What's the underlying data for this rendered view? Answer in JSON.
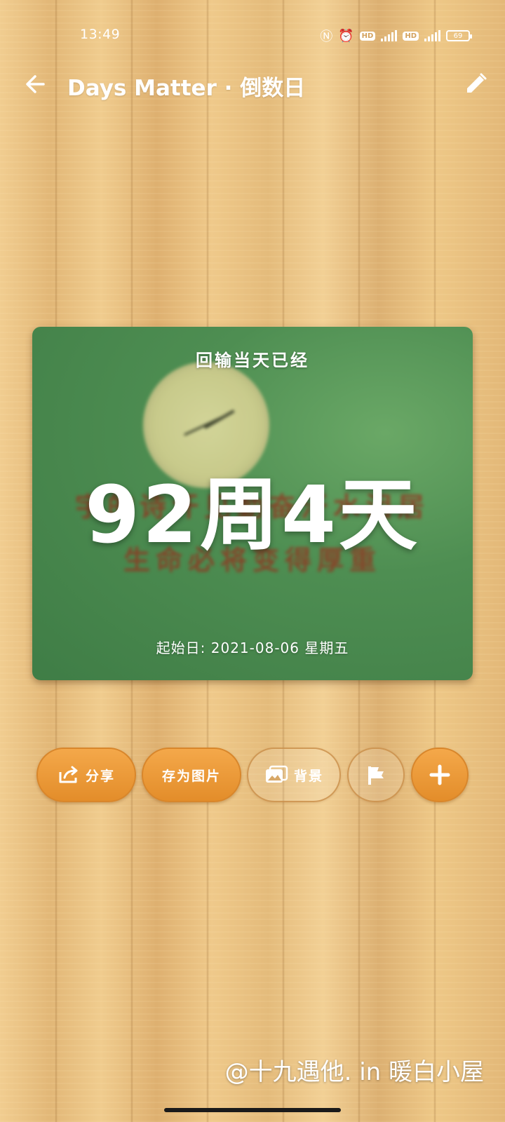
{
  "status_bar": {
    "time": "13:49",
    "nfc_glyph": "Ⓝ",
    "alarm_glyph": "⏰",
    "hd1": "HD",
    "hd2": "HD",
    "battery": "69"
  },
  "header": {
    "title": "Days Matter · 倒数日",
    "back_icon": "arrow-left-icon",
    "edit_icon": "pencil-icon"
  },
  "card": {
    "subtitle": "回输当天已经",
    "big_value": "92周4天",
    "start_date": "起始日: 2021-08-06 星期五",
    "background_text_line1": "宇的诗汗见勤奋汗水泪居",
    "background_text_line2": "生命必将变得厚重"
  },
  "actions": {
    "share_label": "分享",
    "save_image_label": "存为图片",
    "background_label": "背景",
    "flag_icon": "flag-icon",
    "add_icon": "plus-icon"
  },
  "watermark": "@十九遇他. in 暖白小屋",
  "colors": {
    "accent_orange": "#EE9B3A",
    "card_green": "#4E8E52"
  }
}
